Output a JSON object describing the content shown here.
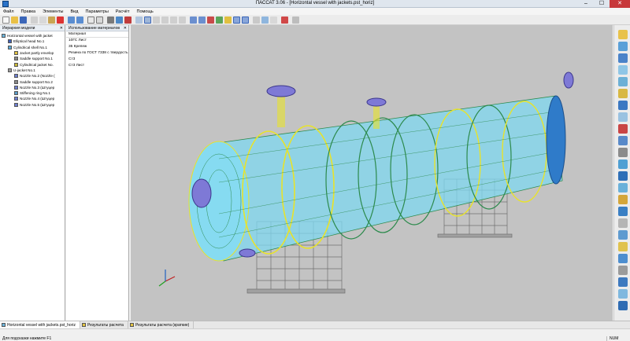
{
  "window": {
    "title": "ПАССАТ 3.06 - [Horizontal vessel with jackets.pst_horiz]"
  },
  "menu": [
    "Файл",
    "Правка",
    "Элементы",
    "Вид",
    "Параметры",
    "Расчёт",
    "Помощь"
  ],
  "left_panel": {
    "title": "Иерархия модели",
    "items": [
      {
        "label": "Horizontal vessel with jacket",
        "depth": 0,
        "color": "#6cb5dc"
      },
      {
        "label": "Elliptical head No.1",
        "depth": 1,
        "color": "#3f5fb5"
      },
      {
        "label": "Cylindrical shell No.1",
        "depth": 1,
        "color": "#58a9d8"
      },
      {
        "label": "Jacket partly envelop",
        "depth": 2,
        "color": "#e2c342"
      },
      {
        "label": "Saddle support No.1",
        "depth": 2,
        "color": "#8a8a8a"
      },
      {
        "label": "Cylindrical jacket No.",
        "depth": 2,
        "color": "#c9b93a"
      },
      {
        "label": "U-jacket No.1",
        "depth": 1,
        "color": "#9a9a9a"
      },
      {
        "label": "Nozzle No.2 (Nozzle (",
        "depth": 2,
        "color": "#6e7fcf"
      },
      {
        "label": "Saddle support No.2",
        "depth": 2,
        "color": "#8a8a8a"
      },
      {
        "label": "Nozzle No.3 (Штуцер",
        "depth": 2,
        "color": "#6e7fcf"
      },
      {
        "label": "Stiffening ring No.1",
        "depth": 2,
        "color": "#5a9cc7"
      },
      {
        "label": "Nozzle No.4 (Штуцер",
        "depth": 2,
        "color": "#6e7fcf"
      },
      {
        "label": "Nozzle No.5 (Штуцер",
        "depth": 2,
        "color": "#6e7fcf"
      }
    ]
  },
  "mid_panel": {
    "title": "Использование материалов",
    "header": "Материал",
    "items": [
      "10ГС Лист",
      "35 Крепеж",
      "Резина по ГОСТ 7338 с твердость",
      "Ст3",
      "Ст3 Лист"
    ]
  },
  "tabs": [
    {
      "label": "Horizontal vessel with jackets.pst_horiz",
      "active": true
    },
    {
      "label": "Результаты расчета",
      "active": false
    },
    {
      "label": "Результаты расчета (краткие)",
      "active": false
    }
  ],
  "status": {
    "hint": "Для подсказки нажмите F1",
    "mode": "NUM"
  },
  "colors": {
    "viewport_bg": "#c3c3c3",
    "shell": "#7fd8f0",
    "head_blue": "#2f7bc9",
    "wire_yellow": "#e8e32a",
    "wire_green": "#2c8a4c",
    "support": "#7b7b7b",
    "nozzle": "#7e79d6"
  }
}
